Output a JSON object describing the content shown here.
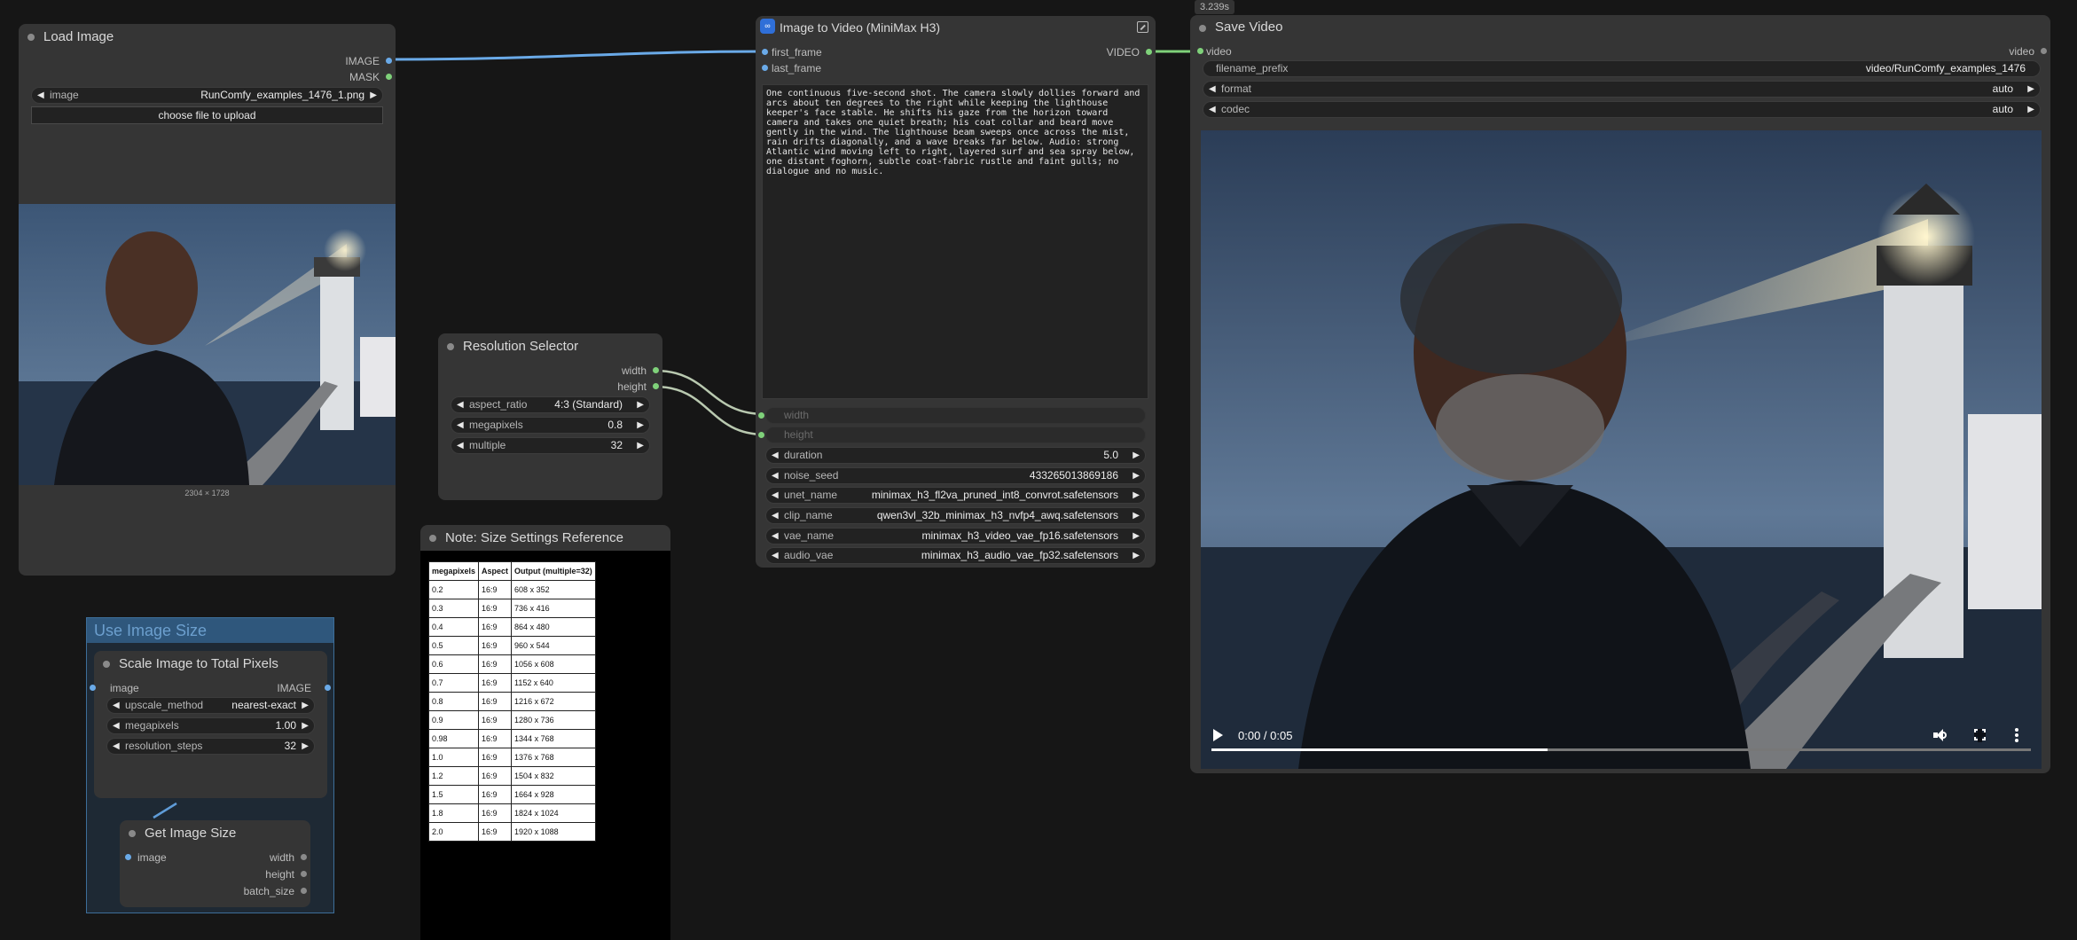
{
  "timer": "3.239s",
  "load_image": {
    "title": "Load Image",
    "out_image": "IMAGE",
    "out_mask": "MASK",
    "image_label": "image",
    "image_value": "RunComfy_examples_1476_1.png",
    "upload_label": "choose file to upload",
    "dims": "2304 × 1728"
  },
  "resolution_selector": {
    "title": "Resolution Selector",
    "out_width": "width",
    "out_height": "height",
    "aspect_label": "aspect_ratio",
    "aspect_value": "4:3 (Standard)",
    "mp_label": "megapixels",
    "mp_value": "0.8",
    "mult_label": "multiple",
    "mult_value": "32"
  },
  "note": {
    "title": "Note: Size Settings Reference",
    "headers": [
      "megapixels",
      "Aspect",
      "Output (multiple=32)"
    ],
    "rows": [
      [
        "0.2",
        "16:9",
        "608 x 352"
      ],
      [
        "0.3",
        "16:9",
        "736 x 416"
      ],
      [
        "0.4",
        "16:9",
        "864 x 480"
      ],
      [
        "0.5",
        "16:9",
        "960 x 544"
      ],
      [
        "0.6",
        "16:9",
        "1056 x 608"
      ],
      [
        "0.7",
        "16:9",
        "1152 x 640"
      ],
      [
        "0.8",
        "16:9",
        "1216 x 672"
      ],
      [
        "0.9",
        "16:9",
        "1280 x 736"
      ],
      [
        "0.98",
        "16:9",
        "1344 x 768"
      ],
      [
        "1.0",
        "16:9",
        "1376 x 768"
      ],
      [
        "1.2",
        "16:9",
        "1504 x 832"
      ],
      [
        "1.5",
        "16:9",
        "1664 x 928"
      ],
      [
        "1.8",
        "16:9",
        "1824 x 1024"
      ],
      [
        "2.0",
        "16:9",
        "1920 x 1088"
      ]
    ]
  },
  "group": {
    "title": "Use Image Size",
    "scale": {
      "title": "Scale Image to Total Pixels",
      "in_image": "image",
      "out_image": "IMAGE",
      "upscale_label": "upscale_method",
      "upscale_value": "nearest-exact",
      "mp_label": "megapixels",
      "mp_value": "1.00",
      "steps_label": "resolution_steps",
      "steps_value": "32"
    },
    "get_size": {
      "title": "Get Image Size",
      "in_image": "image",
      "out_width": "width",
      "out_height": "height",
      "out_batch": "batch_size"
    }
  },
  "i2v": {
    "title": "Image to Video (MiniMax H3)",
    "in_first": "first_frame",
    "in_last": "last_frame",
    "out_video": "VIDEO",
    "prompt": "One continuous five-second shot. The camera slowly dollies forward and arcs about ten degrees to the right while keeping the lighthouse keeper's face stable. He shifts his gaze from the horizon toward camera and takes one quiet breath; his coat collar and beard move gently in the wind. The lighthouse beam sweeps once across the mist, rain drifts diagonally, and a wave breaks far below. Audio: strong Atlantic wind moving left to right, layered surf and sea spray below, one distant foghorn, subtle coat-fabric rustle and faint gulls; no dialogue and no music.",
    "width_label": "width",
    "height_label": "height",
    "duration_label": "duration",
    "duration_value": "5.0",
    "seed_label": "noise_seed",
    "seed_value": "433265013869186",
    "unet_label": "unet_name",
    "unet_value": "minimax_h3_fl2va_pruned_int8_convrot.safetensors",
    "clip_label": "clip_name",
    "clip_value": "qwen3vl_32b_minimax_h3_nvfp4_awq.safetensors",
    "vae_label": "vae_name",
    "vae_value": "minimax_h3_video_vae_fp16.safetensors",
    "audio_vae_label": "audio_vae",
    "audio_vae_value": "minimax_h3_audio_vae_fp32.safetensors"
  },
  "save_video": {
    "title": "Save Video",
    "in_video": "video",
    "out_video": "video",
    "prefix_label": "filename_prefix",
    "prefix_value": "video/RunComfy_examples_1476",
    "format_label": "format",
    "format_value": "auto",
    "codec_label": "codec",
    "codec_value": "auto",
    "time": "0:00 / 0:05",
    "progress": 0.41
  },
  "colors": {
    "link_image": "#6aaae8",
    "link_video": "#7fd17a",
    "link_int": "#b9c9b0",
    "group_border": "#3d6e99"
  }
}
